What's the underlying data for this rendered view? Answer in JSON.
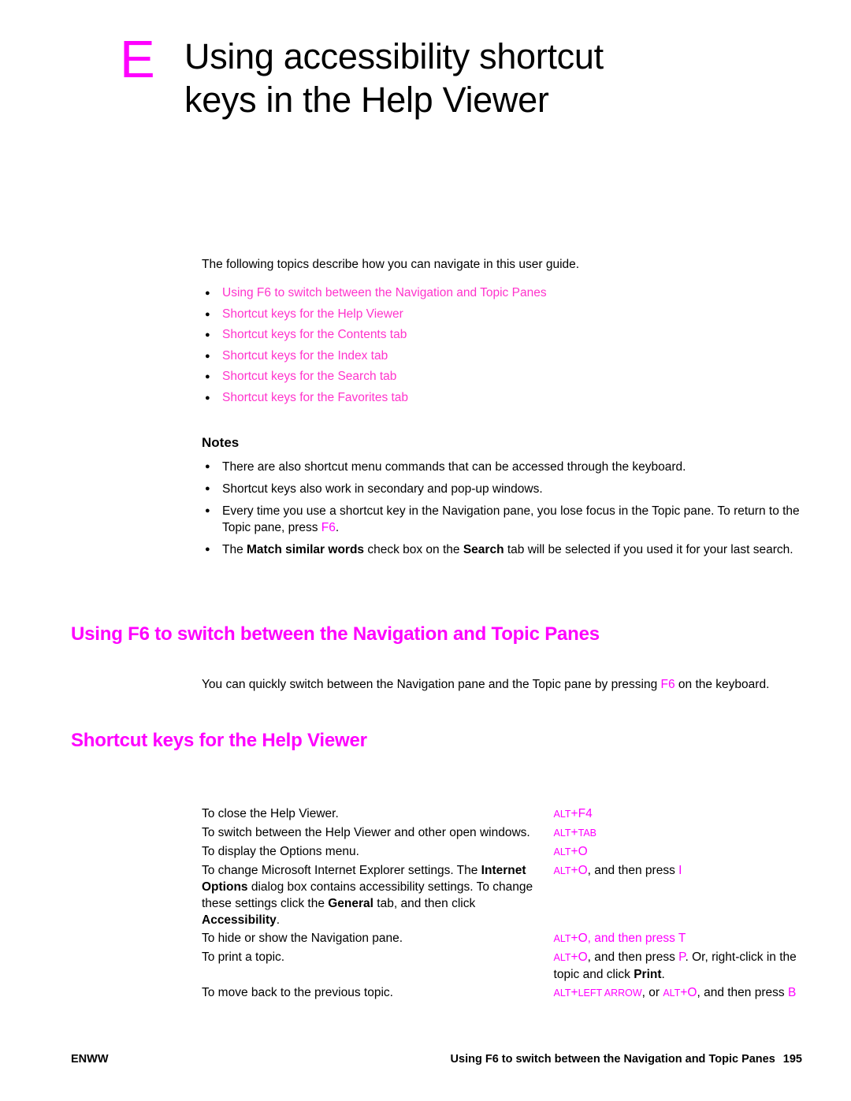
{
  "chapter": {
    "letter": "E",
    "title_line1": "Using accessibility shortcut",
    "title_line2": "keys in the Help Viewer"
  },
  "intro": "The following topics describe how you can navigate in this user guide.",
  "links": [
    "Using F6 to switch between the Navigation and Topic Panes",
    "Shortcut keys for the Help Viewer",
    "Shortcut keys for the Contents tab",
    "Shortcut keys for the Index tab",
    "Shortcut keys for the Search tab",
    "Shortcut keys for the Favorites tab"
  ],
  "notes": {
    "heading": "Notes",
    "items": [
      "There are also shortcut menu commands that can be accessed through the keyboard.",
      "Shortcut keys also work in secondary and pop-up windows."
    ]
  },
  "notes_item3": {
    "part1": "Every time you use a shortcut key in the Navigation pane, you lose focus in the Topic pane. To return to the Topic pane, press ",
    "key": "F6",
    "part2": "."
  },
  "notes_item4": {
    "part1": "The ",
    "bold1": "Match similar words",
    "part2": " check box on the ",
    "bold2": "Search",
    "part3": " tab will be selected if you used it for your last search."
  },
  "section_f6": {
    "heading": "Using F6 to switch between the Navigation and Topic Panes",
    "para_part1": "You can quickly switch between the Navigation pane and the Topic pane by pressing ",
    "para_key": "F6",
    "para_part2": " on the keyboard."
  },
  "section_shortcut": {
    "heading": "Shortcut keys for the Help Viewer"
  },
  "table": {
    "rows": [
      {
        "desc": "To close the Help Viewer.",
        "keys_alt": "ALT",
        "keys_plus": "+",
        "keys_rest": "F4"
      },
      {
        "desc": "To switch between the Help Viewer and other open windows.",
        "keys_alt": "ALT",
        "keys_plus": "+",
        "keys_rest": "TAB"
      },
      {
        "desc": "To display the Options menu.",
        "keys_alt": "ALT",
        "keys_plus": "+",
        "keys_rest": "O"
      },
      {
        "desc": "To hide or show the Navigation pane.",
        "keys_alt": "ALT",
        "keys_plus": "+",
        "keys_rest": "O, and then press T"
      }
    ],
    "row4": {
      "d_part1": "To change Microsoft Internet Explorer settings. The ",
      "d_bold1": "Internet Options",
      "d_part2": " dialog box contains accessibility settings. To change these settings click the ",
      "d_bold2": "General",
      "d_part3": " tab, and then click ",
      "d_bold3": "Accessibility",
      "d_part4": ".",
      "k_alt": "ALT",
      "k_plus": "+",
      "k_o": "O",
      "k_mid": ", and then press ",
      "k_end": "I"
    },
    "row_print": {
      "desc": "To print a topic.",
      "k_alt": "ALT",
      "k_plus": "+",
      "k_o": "O",
      "k_mid": ", and then press ",
      "k_p": "P",
      "k_rest": ". Or, right-click in the topic and click ",
      "k_bold": "Print",
      "k_end": "."
    },
    "row_back": {
      "desc": "To move back to the previous topic.",
      "k_alt1": "ALT",
      "k_plus1": "+",
      "k_leftarrow": "LEFT ARROW",
      "k_or": ", or ",
      "k_alt2": "ALT",
      "k_plus2": "+",
      "k_o": "O",
      "k_mid": ", and then press ",
      "k_b": "B"
    }
  },
  "footer": {
    "left": "ENWW",
    "right": "Using F6 to switch between the Navigation and Topic Panes",
    "page": "195"
  }
}
